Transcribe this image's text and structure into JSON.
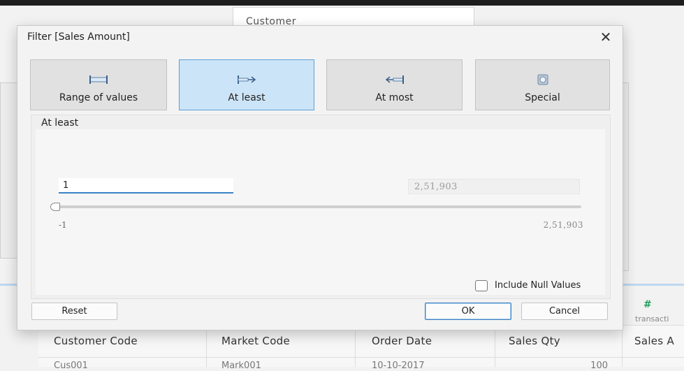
{
  "background": {
    "customer_header": "Customer",
    "table": {
      "columns": [
        "Customer Code",
        "Market Code",
        "Order Date",
        "Sales Qty",
        "Sales A"
      ],
      "first_row": [
        "Cus001",
        "Mark001",
        "10-10-2017",
        "100",
        ""
      ]
    },
    "field_card": {
      "type_glyph": "#",
      "label": "transacti"
    }
  },
  "dialog": {
    "title": "Filter [Sales Amount]",
    "close_glyph": "✕",
    "modes": [
      {
        "label": "Range of values",
        "icon": "range-icon",
        "active": false
      },
      {
        "label": "At least",
        "icon": "at-least-icon",
        "active": true
      },
      {
        "label": "At most",
        "icon": "at-most-icon",
        "active": false
      },
      {
        "label": "Special",
        "icon": "special-icon",
        "active": false
      }
    ],
    "panel_title": "At least",
    "input_value": "1",
    "max_display": "2,51,903",
    "range_min_label": "-1",
    "range_max_label": "2,51,903",
    "include_null_label": "Include Null Values",
    "include_null_checked": false,
    "reset_label": "Reset",
    "ok_label": "OK",
    "cancel_label": "Cancel"
  },
  "colors": {
    "active_mode_bg": "#cce4f7",
    "active_mode_border": "#5aa0d8",
    "accent": "#3b82c4",
    "hash_green": "#1f9e5b"
  }
}
